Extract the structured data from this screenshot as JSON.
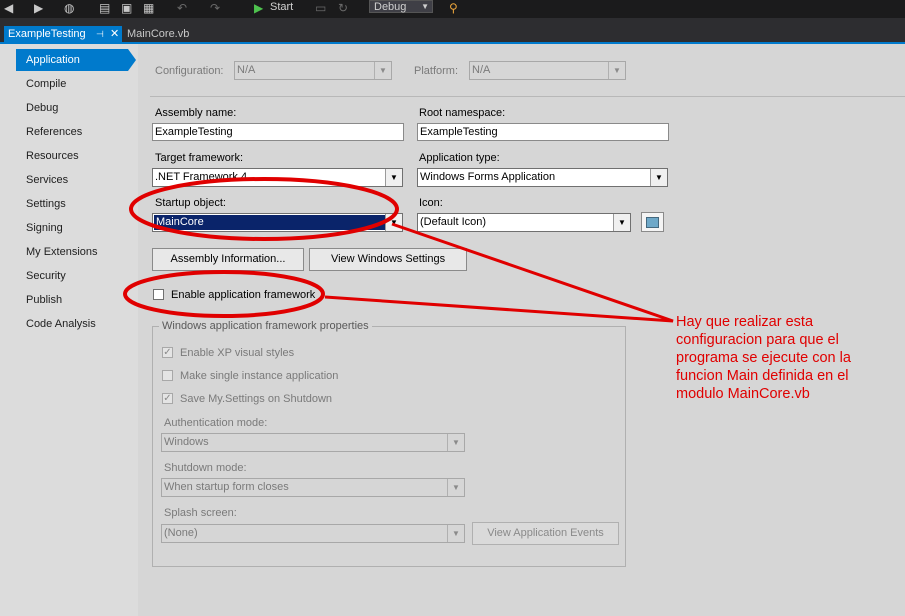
{
  "toolbar": {
    "start_label": "Start",
    "configuration": "Debug"
  },
  "tabs": {
    "active": "ExampleTesting",
    "pin_glyph": "⊣",
    "close_glyph": "✕",
    "second": "MainCore.vb"
  },
  "nav": {
    "active": "Application",
    "items": [
      "Compile",
      "Debug",
      "References",
      "Resources",
      "Services",
      "Settings",
      "Signing",
      "My Extensions",
      "Security",
      "Publish",
      "Code Analysis"
    ]
  },
  "config_row": {
    "configuration_label": "Configuration:",
    "configuration_value": "N/A",
    "platform_label": "Platform:",
    "platform_value": "N/A"
  },
  "assembly_name": {
    "label": "Assembly name:",
    "value": "ExampleTesting"
  },
  "root_namespace": {
    "label": "Root namespace:",
    "value": "ExampleTesting"
  },
  "target_framework": {
    "label": "Target framework:",
    "value": ".NET Framework 4"
  },
  "application_type": {
    "label": "Application type:",
    "value": "Windows Forms Application"
  },
  "startup_object": {
    "label": "Startup object:",
    "value": "MainCore"
  },
  "icon": {
    "label": "Icon:",
    "value": "(Default Icon)"
  },
  "buttons": {
    "assembly_information": "Assembly Information...",
    "view_windows_settings": "View Windows Settings",
    "view_application_events": "View Application Events"
  },
  "enable_framework": {
    "label": "Enable application framework",
    "checked": false
  },
  "framework_group": {
    "title": "Windows application framework properties",
    "xp_styles": {
      "label": "Enable XP visual styles",
      "checked": true
    },
    "single_instance": {
      "label": "Make single instance application",
      "checked": false
    },
    "save_settings": {
      "label": "Save My.Settings on Shutdown",
      "checked": true
    },
    "authentication_mode": {
      "label": "Authentication mode:",
      "value": "Windows"
    },
    "shutdown_mode": {
      "label": "Shutdown mode:",
      "value": "When startup form closes"
    },
    "splash_screen": {
      "label": "Splash screen:",
      "value": "(None)"
    }
  },
  "annotation": {
    "text": "Hay que realizar esta configuracion para que el programa se ejecute con la funcion Main definida en el modulo MainCore.vb",
    "color": "#e00000"
  },
  "colors": {
    "accent": "#007acc",
    "selection": "#0a246a"
  }
}
